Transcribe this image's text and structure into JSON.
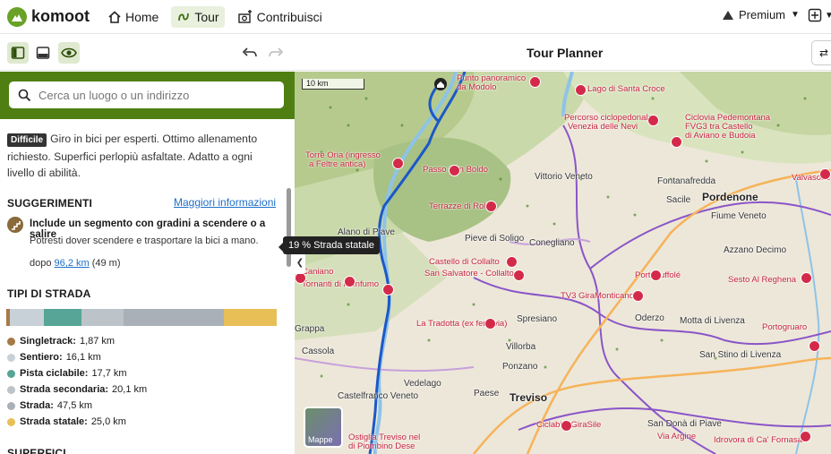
{
  "topnav": {
    "brand": "komoot",
    "items": [
      {
        "label": "Home",
        "icon": "home-icon",
        "active": false
      },
      {
        "label": "Tour",
        "icon": "route-icon",
        "active": true
      },
      {
        "label": "Contribuisci",
        "icon": "contribute-icon",
        "active": false
      }
    ],
    "premium_label": "Premium"
  },
  "toolbar": {
    "title": "Tour Planner"
  },
  "search": {
    "placeholder": "Cerca un luogo o un indirizzo"
  },
  "difficulty": {
    "badge": "Difficile",
    "description": "Giro in bici per esperti. Ottimo allenamento richiesto. Superfici perlopiù asfaltate. Adatto a ogni livello di abilità."
  },
  "suggestions": {
    "title": "SUGGERIMENTI",
    "more_link": "Maggiori informazioni",
    "item_title": "Include un segmento con gradini a scendere o a salire",
    "item_text": "Potresti dover scendere e trasportare la bici a mano.",
    "dist_prefix": "dopo ",
    "dist_link": "96,2 km",
    "dist_suffix": " (49 m)"
  },
  "road_types": {
    "title": "TIPI DI STRADA",
    "tooltip": "19 % Strada statale",
    "items": [
      {
        "label": "Singletrack:",
        "value": "1,87 km",
        "km": 1.87,
        "color": "#a57a45"
      },
      {
        "label": "Sentiero:",
        "value": "16,1 km",
        "km": 16.1,
        "color": "#c9d1d8"
      },
      {
        "label": "Pista ciclabile:",
        "value": "17,7 km",
        "km": 17.7,
        "color": "#56a596"
      },
      {
        "label": "Strada secondaria:",
        "value": "20,1 km",
        "km": 20.1,
        "color": "#bcc3c9"
      },
      {
        "label": "Strada:",
        "value": "47,5 km",
        "km": 47.5,
        "color": "#a9b0b7"
      },
      {
        "label": "Strada statale:",
        "value": "25,0 km",
        "km": 25.0,
        "color": "#e8bf57"
      }
    ]
  },
  "surfaces": {
    "title": "SUPERFICI"
  },
  "map": {
    "scale": "10 km",
    "mappe_label": "Mappe",
    "labels": [
      {
        "text": "Punto panoramico",
        "cls": "red"
      },
      {
        "text": "da Modolo",
        "cls": "red"
      },
      {
        "text": "Lago di Santa Croce",
        "cls": "red"
      },
      {
        "text": "Percorso ciclopedonale",
        "cls": "red"
      },
      {
        "text": "Venezia delle Nevi",
        "cls": "red"
      },
      {
        "text": "Ciclovia Pedemontana",
        "cls": "red"
      },
      {
        "text": "FVG3 tra Castello",
        "cls": "red"
      },
      {
        "text": "di Aviano e Budoia",
        "cls": "red"
      },
      {
        "text": "Torre Oria (ingresso",
        "cls": "red"
      },
      {
        "text": "a Feltre antica)",
        "cls": "red"
      },
      {
        "text": "Passo San Boldo",
        "cls": "red"
      },
      {
        "text": "Vittorio Veneto",
        "cls": ""
      },
      {
        "text": "Fontanafredda",
        "cls": ""
      },
      {
        "text": "Valvasone",
        "cls": "red"
      },
      {
        "text": "Sacile",
        "cls": ""
      },
      {
        "text": "Pordenone",
        "cls": "city"
      },
      {
        "text": "Terrazze di Rolle",
        "cls": "red"
      },
      {
        "text": "Fiume Veneto",
        "cls": ""
      },
      {
        "text": "Alano di Piave",
        "cls": ""
      },
      {
        "text": "Pieve di Soligo",
        "cls": ""
      },
      {
        "text": "Conegliano",
        "cls": ""
      },
      {
        "text": "Azzano Decimo",
        "cls": ""
      },
      {
        "text": "Castello di Collalto",
        "cls": "red"
      },
      {
        "text": "San Salvatore - Collalto",
        "cls": "red"
      },
      {
        "text": "Portobuffolé",
        "cls": "red"
      },
      {
        "text": "Sesto Al Reghena",
        "cls": "red"
      },
      {
        "text": "Caniano",
        "cls": "red"
      },
      {
        "text": "Tornanti di Monfumo",
        "cls": "red"
      },
      {
        "text": "TV3 GiraMonticano",
        "cls": "red"
      },
      {
        "text": "La Tradotta (ex ferrovia)",
        "cls": "red"
      },
      {
        "text": "Oderzo",
        "cls": ""
      },
      {
        "text": "Motta di Livenza",
        "cls": ""
      },
      {
        "text": "Portogruaro",
        "cls": "red"
      },
      {
        "text": "Grappa",
        "cls": ""
      },
      {
        "text": "Spresiano",
        "cls": ""
      },
      {
        "text": "Cassola",
        "cls": ""
      },
      {
        "text": "Villorba",
        "cls": ""
      },
      {
        "text": "San Stino di Livenza",
        "cls": ""
      },
      {
        "text": "Ponzano",
        "cls": ""
      },
      {
        "text": "Vedelago",
        "cls": ""
      },
      {
        "text": "Castelfranco Veneto",
        "cls": ""
      },
      {
        "text": "Paese",
        "cls": ""
      },
      {
        "text": "Treviso",
        "cls": "city"
      },
      {
        "text": "Ciclabile GiraSile",
        "cls": "red"
      },
      {
        "text": "San Donà di Piave",
        "cls": ""
      },
      {
        "text": "Via Argine",
        "cls": "red"
      },
      {
        "text": "Idrovora di Ca' Fornasa",
        "cls": "red"
      },
      {
        "text": "Ostiglia Treviso nel",
        "cls": "red"
      },
      {
        "text": "di Piombino Dese",
        "cls": "red"
      }
    ]
  }
}
